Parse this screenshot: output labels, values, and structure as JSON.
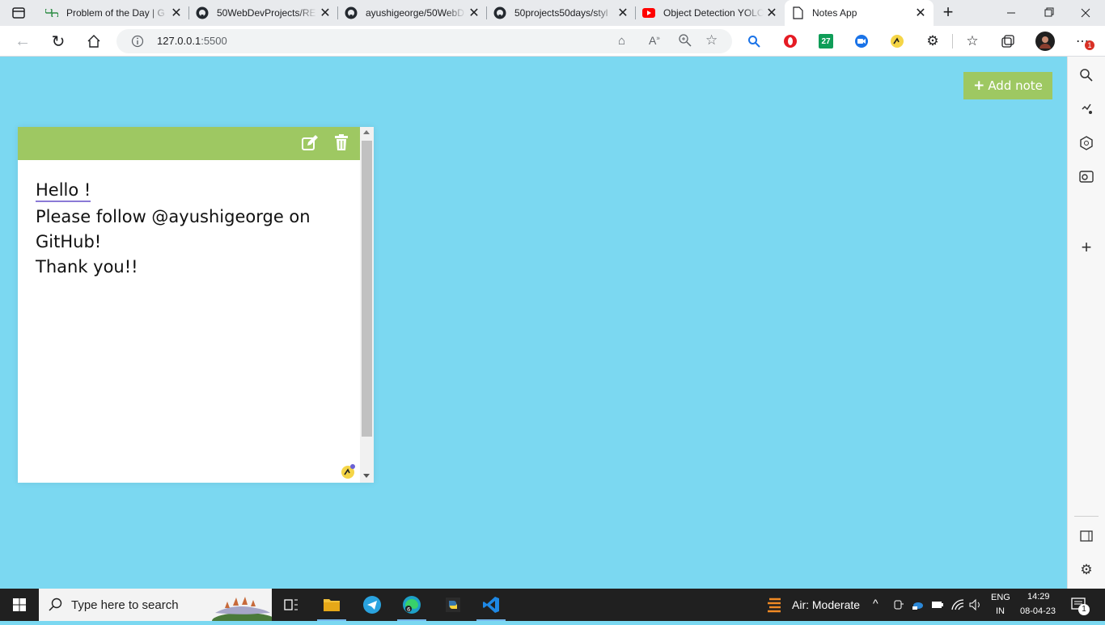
{
  "browser": {
    "tabs": [
      {
        "title": "Problem of the Day | G",
        "icon": "geeksforgeeks-icon",
        "active": false
      },
      {
        "title": "50WebDevProjects/RE",
        "icon": "github-icon",
        "active": false
      },
      {
        "title": "ayushigeorge/50WebD",
        "icon": "github-icon",
        "active": false
      },
      {
        "title": "50projects50days/styl",
        "icon": "github-icon",
        "active": false
      },
      {
        "title": "Object Detection YOLO",
        "icon": "youtube-icon",
        "active": false
      },
      {
        "title": "Notes App",
        "icon": "page-icon",
        "active": true
      }
    ],
    "address": {
      "host": "127.0.0.1",
      "port": ":5500"
    },
    "extension_badges": {
      "calendar": "27",
      "notifications": "1"
    }
  },
  "page": {
    "add_note_label": "Add note",
    "note": {
      "lines": [
        "Hello !",
        "Please follow @ayushigeorge on",
        "GitHub!",
        "Thank you!!"
      ]
    }
  },
  "taskbar": {
    "search_placeholder": "Type here to search",
    "weather": "Air: Moderate",
    "language": "ENG",
    "region": "IN",
    "time": "14:29",
    "date": "08-04-23",
    "notification_count": "1"
  },
  "colors": {
    "page_background": "#7bd8f1",
    "accent_green": "#9ec862",
    "taskbar": "#202020"
  }
}
